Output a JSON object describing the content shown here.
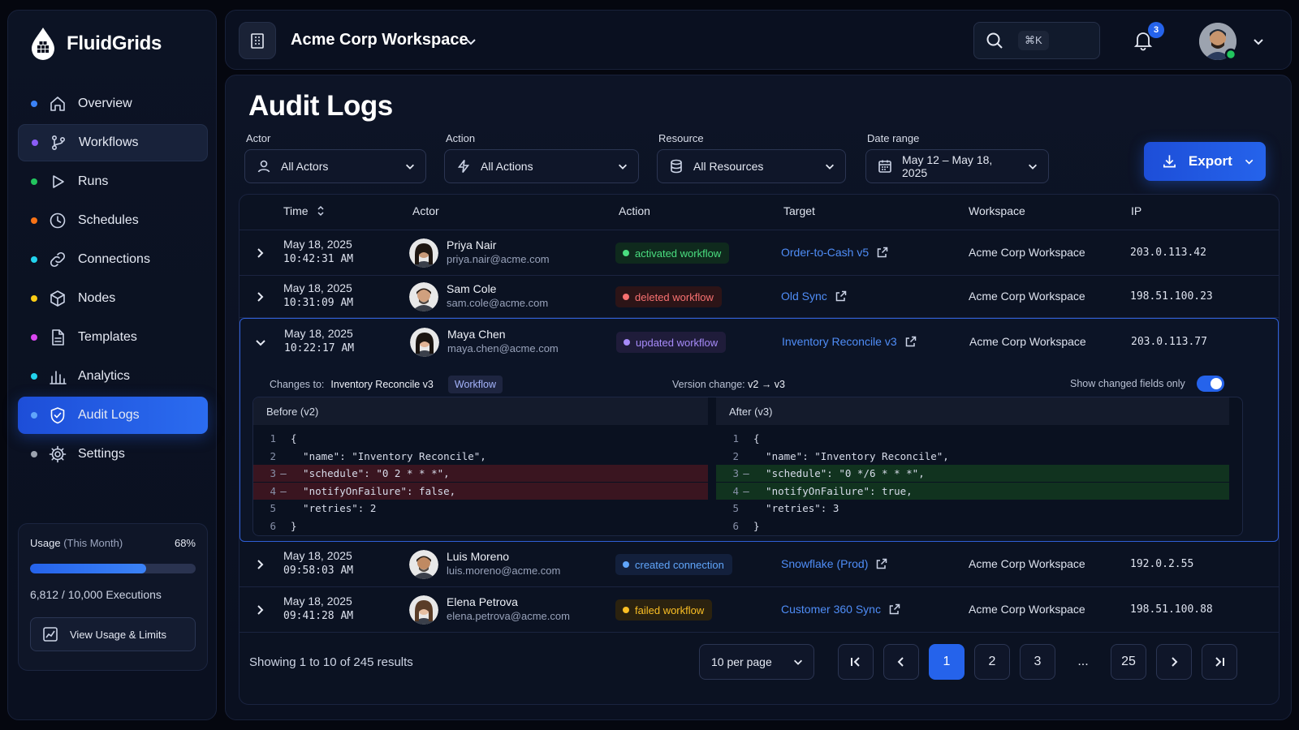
{
  "brand": {
    "name": "FluidGrids"
  },
  "nav": [
    {
      "label": "Overview",
      "icon": "home-icon",
      "dot": "#3b82f6"
    },
    {
      "label": "Workflows",
      "icon": "branch-icon",
      "dot": "#8b5cf6"
    },
    {
      "label": "Runs",
      "icon": "play-icon",
      "dot": "#22c55e"
    },
    {
      "label": "Schedules",
      "icon": "clock-icon",
      "dot": "#f97316"
    },
    {
      "label": "Connections",
      "icon": "link-icon",
      "dot": "#22d3ee"
    },
    {
      "label": "Nodes",
      "icon": "cube-icon",
      "dot": "#facc15"
    },
    {
      "label": "Templates",
      "icon": "file-icon",
      "dot": "#d946ef"
    },
    {
      "label": "Analytics",
      "icon": "bar-chart-icon",
      "dot": "#22d3ee"
    },
    {
      "label": "Audit Logs",
      "icon": "shield-icon",
      "dot": "#60a5fa"
    },
    {
      "label": "Settings",
      "icon": "gear-icon",
      "dot": "#9ca3af"
    }
  ],
  "usage": {
    "title": "Usage",
    "period": "(This Month)",
    "percent_label": "68%",
    "percent": 0.7,
    "executions": "6,812 / 10,000 Executions",
    "button": "View Usage & Limits"
  },
  "topbar": {
    "workspace": "Acme Corp Workspace",
    "shortcut": "⌘K",
    "notifications": "3"
  },
  "page": {
    "title": "Audit Logs"
  },
  "filters": {
    "actor": {
      "label": "Actor",
      "value": "All Actors"
    },
    "action": {
      "label": "Action",
      "value": "All Actions"
    },
    "resource": {
      "label": "Resource",
      "value": "All Resources"
    },
    "date": {
      "label": "Date range",
      "value": "May 12 – May 18, 2025"
    },
    "export": "Export"
  },
  "table": {
    "headers": [
      "Time",
      "Actor",
      "Action",
      "Target",
      "Workspace",
      "IP"
    ],
    "rows": [
      {
        "date": "May 18, 2025",
        "time": "10:42:31 AM",
        "name": "Priya Nair",
        "email": "priya.nair@acme.com",
        "action": "activated workflow",
        "status": "green",
        "target": "Order-to-Cash v5",
        "workspace": "Acme Corp Workspace",
        "ip": "203.0.113.42"
      },
      {
        "date": "May 18, 2025",
        "time": "10:31:09 AM",
        "name": "Sam Cole",
        "email": "sam.cole@acme.com",
        "action": "deleted workflow",
        "status": "red",
        "target": "Old Sync",
        "workspace": "Acme Corp Workspace",
        "ip": "198.51.100.23"
      },
      {
        "date": "May 18, 2025",
        "time": "10:22:17 AM",
        "name": "Maya Chen",
        "email": "maya.chen@acme.com",
        "action": "updated workflow",
        "status": "purple",
        "target": "Inventory Reconcile v3",
        "workspace": "Acme Corp Workspace",
        "ip": "203.0.113.77"
      },
      {
        "date": "May 18, 2025",
        "time": "09:58:03 AM",
        "name": "Luis Moreno",
        "email": "luis.moreno@acme.com",
        "action": "created connection",
        "status": "blue",
        "target": "Snowflake (Prod)",
        "workspace": "Acme Corp Workspace",
        "ip": "192.0.2.55"
      },
      {
        "date": "May 18, 2025",
        "time": "09:41:28 AM",
        "name": "Elena Petrova",
        "email": "elena.petrova@acme.com",
        "action": "failed workflow",
        "status": "amber",
        "target": "Customer 360 Sync",
        "workspace": "Acme Corp Workspace",
        "ip": "198.51.100.88"
      }
    ]
  },
  "details": {
    "changes_label": "Changes to:",
    "changes_target": "Inventory Reconcile v3",
    "tag": "Workflow",
    "version_label": "Version change:",
    "version_value": "v2 → v3",
    "toggle_label": "Show changed fields only",
    "before_title": "Before (v2)",
    "after_title": "After (v3)",
    "before_lines": [
      {
        "n": "1",
        "m": "",
        "code": "{",
        "type": ""
      },
      {
        "n": "2",
        "m": "",
        "code": "  \"name\": \"Inventory Reconcile\",",
        "type": ""
      },
      {
        "n": "3",
        "m": "–",
        "code": "  \"schedule\": \"0 2 * * *\",",
        "type": "del"
      },
      {
        "n": "4",
        "m": "–",
        "code": "  \"notifyOnFailure\": false,",
        "type": "del"
      },
      {
        "n": "5",
        "m": "",
        "code": "  \"retries\": 2",
        "type": ""
      },
      {
        "n": "6",
        "m": "",
        "code": "}",
        "type": ""
      }
    ],
    "after_lines": [
      {
        "n": "1",
        "m": "",
        "code": "{",
        "type": ""
      },
      {
        "n": "2",
        "m": "",
        "code": "  \"name\": \"Inventory Reconcile\",",
        "type": ""
      },
      {
        "n": "3",
        "m": "–",
        "code": "  \"schedule\": \"0 */6 * * *\",",
        "type": "add"
      },
      {
        "n": "4",
        "m": "–",
        "code": "  \"notifyOnFailure\": true,",
        "type": "add"
      },
      {
        "n": "5",
        "m": "",
        "code": "  \"retries\": 3",
        "type": ""
      },
      {
        "n": "6",
        "m": "",
        "code": "}",
        "type": ""
      }
    ]
  },
  "footer": {
    "showing": "Showing 1 to 10 of 245 results",
    "per_page": "10 per page",
    "pages": [
      "1",
      "2",
      "3",
      "...",
      "25"
    ]
  },
  "colors": {
    "accent": "#2563eb",
    "green": "#4ade80",
    "red": "#f87171",
    "purple": "#a78bfa",
    "blue": "#60a5fa",
    "amber": "#fbbf24"
  }
}
